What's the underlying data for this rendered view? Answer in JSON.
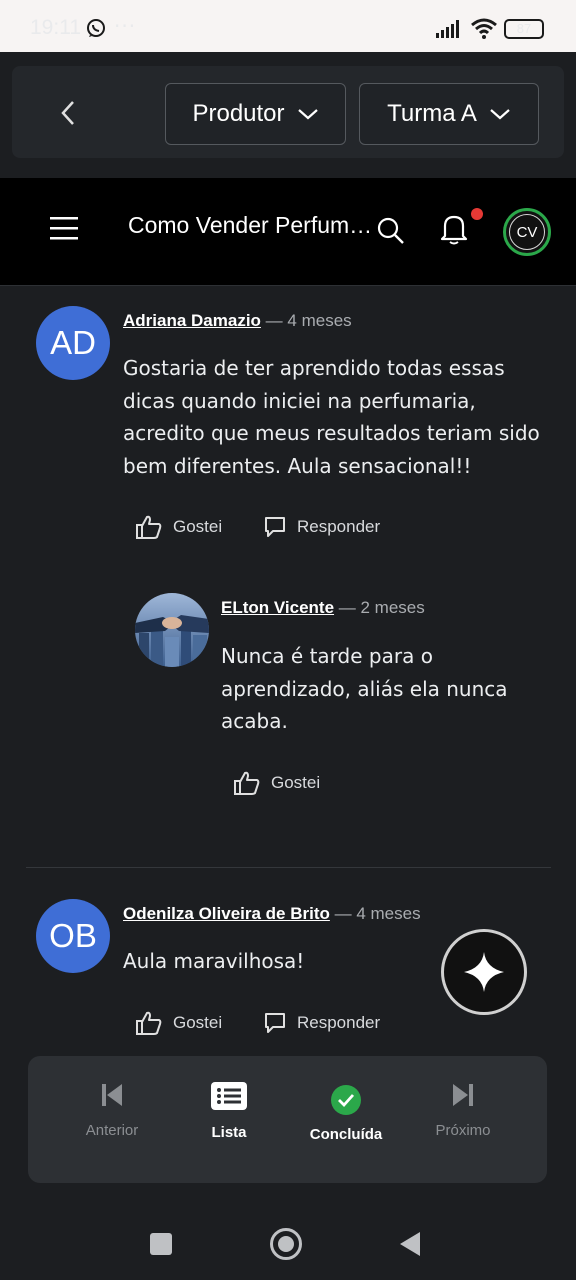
{
  "status_bar": {
    "time": "19:11",
    "battery": "87"
  },
  "header": {
    "producer_select": "Produtor",
    "class_select": "Turma A",
    "course_title": "Como Vender Perfumes do Zero",
    "user_initials": "CV"
  },
  "comments": [
    {
      "avatar_initials": "AD",
      "author": "Adriana Damazio",
      "time": "— 4 meses",
      "text": "Gostaria de ter aprendido todas essas dicas quando iniciei na perfumaria, acredito que meus resultados teriam sido bem diferentes. Aula sensacional!!",
      "like_label": "Gostei",
      "reply_label": "Responder",
      "replies": [
        {
          "author": "ELton Vicente",
          "time": "— 2 meses",
          "text": "Nunca é tarde para o aprendizado, aliás ela nunca acaba.",
          "like_label": "Gostei"
        }
      ]
    },
    {
      "avatar_initials": "OB",
      "author": "Odenilza Oliveira de Brito",
      "time": "— 4 meses",
      "text": "Aula maravilhosa!",
      "like_label": "Gostei",
      "reply_label": "Responder"
    }
  ],
  "bottom_nav": {
    "previous": "Anterior",
    "list": "Lista",
    "completed": "Concluída",
    "next": "Próximo"
  },
  "colors": {
    "avatar": "#3f6ed6",
    "completed_green": "#2ba84a",
    "notification_dot": "#e53935",
    "background": "#1c1e21"
  },
  "icons": [
    "back-icon",
    "chevron-down-icon",
    "menu-icon",
    "search-icon",
    "bell-icon",
    "thumbs-up-icon",
    "comment-icon",
    "sparkle-icon",
    "skip-previous-icon",
    "list-icon",
    "check-circle-icon",
    "skip-next-icon"
  ]
}
